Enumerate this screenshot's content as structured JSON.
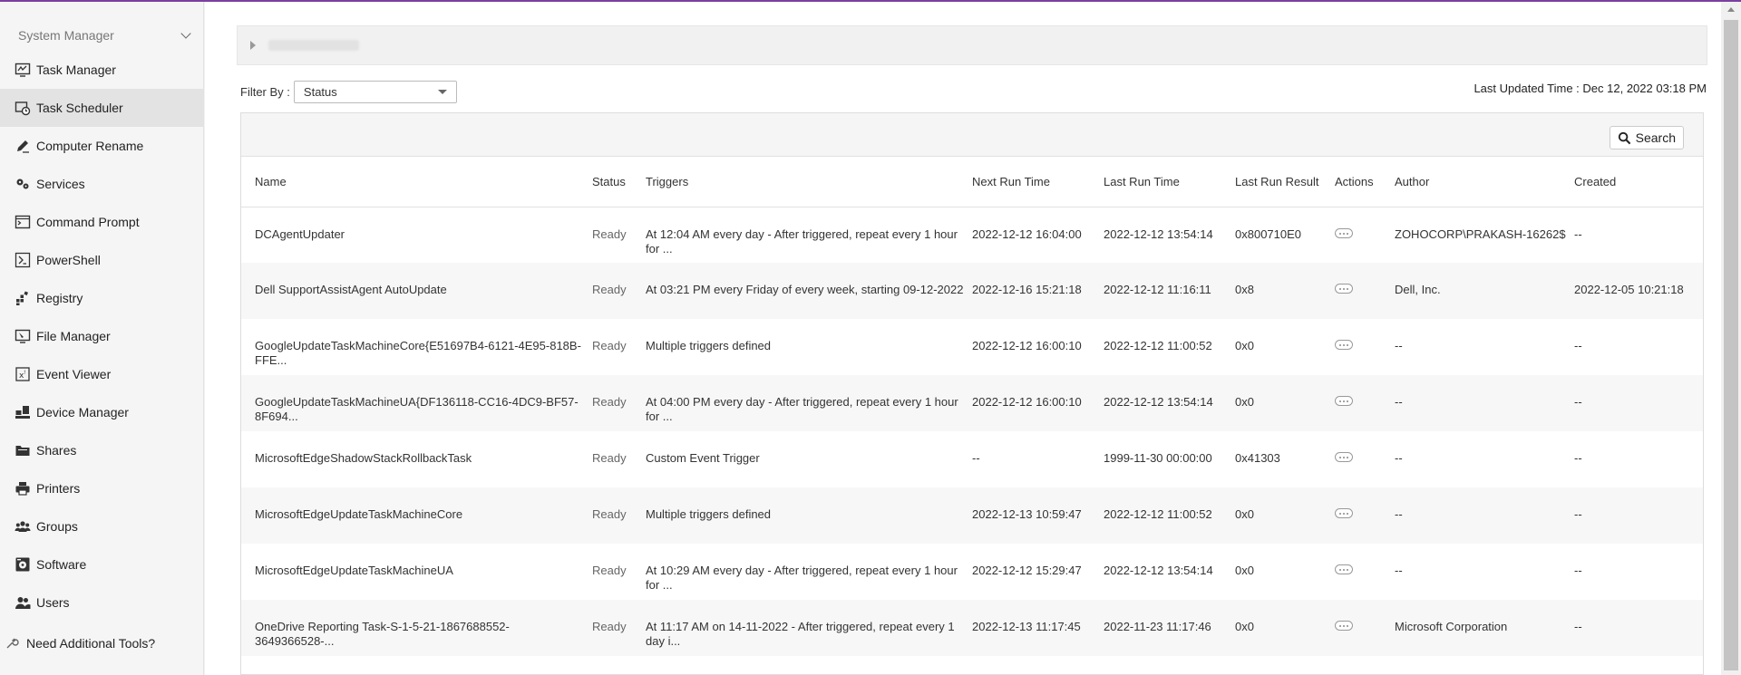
{
  "sidebar": {
    "header": "System Manager",
    "items": [
      {
        "label": "Task Manager",
        "icon": "task-manager-icon"
      },
      {
        "label": "Task Scheduler",
        "icon": "task-scheduler-icon",
        "active": true
      },
      {
        "label": "Computer Rename",
        "icon": "pen-icon"
      },
      {
        "label": "Services",
        "icon": "services-icon"
      },
      {
        "label": "Command Prompt",
        "icon": "command-prompt-icon"
      },
      {
        "label": "PowerShell",
        "icon": "powershell-icon"
      },
      {
        "label": "Registry",
        "icon": "registry-icon"
      },
      {
        "label": "File Manager",
        "icon": "file-manager-icon"
      },
      {
        "label": "Event Viewer",
        "icon": "event-viewer-icon"
      },
      {
        "label": "Device Manager",
        "icon": "device-manager-icon"
      },
      {
        "label": "Shares",
        "icon": "shares-icon"
      },
      {
        "label": "Printers",
        "icon": "printer-icon"
      },
      {
        "label": "Groups",
        "icon": "groups-icon"
      },
      {
        "label": "Software",
        "icon": "software-icon"
      },
      {
        "label": "Users",
        "icon": "users-icon"
      }
    ],
    "footer": "Need Additional Tools?"
  },
  "filter": {
    "label": "Filter By :",
    "selected": "Status"
  },
  "last_updated": "Last Updated Time : Dec 12, 2022 03:18 PM",
  "search_label": "Search",
  "table": {
    "headers": [
      "Name",
      "Status",
      "Triggers",
      "Next Run Time",
      "Last Run Time",
      "Last Run Result",
      "Actions",
      "Author",
      "Created"
    ],
    "rows": [
      {
        "name": "DCAgentUpdater",
        "status": "Ready",
        "triggers": "At 12:04 AM every day - After triggered, repeat every 1 hour for ...",
        "next": "2022-12-12 16:04:00",
        "last": "2022-12-12 13:54:14",
        "result": "0x800710E0",
        "author": "ZOHOCORP\\PRAKASH-16262$",
        "created": "--"
      },
      {
        "name": "Dell SupportAssistAgent AutoUpdate",
        "status": "Ready",
        "triggers": "At 03:21 PM every Friday of every week, starting 09-12-2022",
        "next": "2022-12-16 15:21:18",
        "last": "2022-12-12 11:16:11",
        "result": "0x8",
        "author": "Dell, Inc.",
        "created": "2022-12-05 10:21:18"
      },
      {
        "name": "GoogleUpdateTaskMachineCore{E51697B4-6121-4E95-818B-FFE...",
        "status": "Ready",
        "triggers": "Multiple triggers defined",
        "next": "2022-12-12 16:00:10",
        "last": "2022-12-12 11:00:52",
        "result": "0x0",
        "author": "--",
        "created": "--"
      },
      {
        "name": "GoogleUpdateTaskMachineUA{DF136118-CC16-4DC9-BF57-8F694...",
        "status": "Ready",
        "triggers": "At 04:00 PM every day - After triggered, repeat every 1 hour for ...",
        "next": "2022-12-12 16:00:10",
        "last": "2022-12-12 13:54:14",
        "result": "0x0",
        "author": "--",
        "created": "--"
      },
      {
        "name": "MicrosoftEdgeShadowStackRollbackTask",
        "status": "Ready",
        "triggers": "Custom Event Trigger",
        "next": "--",
        "last": "1999-11-30 00:00:00",
        "result": "0x41303",
        "author": "--",
        "created": "--"
      },
      {
        "name": "MicrosoftEdgeUpdateTaskMachineCore",
        "status": "Ready",
        "triggers": "Multiple triggers defined",
        "next": "2022-12-13 10:59:47",
        "last": "2022-12-12 11:00:52",
        "result": "0x0",
        "author": "--",
        "created": "--"
      },
      {
        "name": "MicrosoftEdgeUpdateTaskMachineUA",
        "status": "Ready",
        "triggers": "At 10:29 AM every day - After triggered, repeat every 1 hour for ...",
        "next": "2022-12-12 15:29:47",
        "last": "2022-12-12 13:54:14",
        "result": "0x0",
        "author": "--",
        "created": "--"
      },
      {
        "name": "OneDrive Reporting Task-S-1-5-21-1867688552-3649366528-...",
        "status": "Ready",
        "triggers": "At 11:17 AM on 14-11-2022 - After triggered, repeat every 1 day i...",
        "next": "2022-12-13 11:17:45",
        "last": "2022-11-23 11:17:46",
        "result": "0x0",
        "author": "Microsoft Corporation",
        "created": "--"
      }
    ]
  },
  "colors": {
    "accent": "#7b3fa0",
    "active_bg": "#e3e3e3"
  }
}
